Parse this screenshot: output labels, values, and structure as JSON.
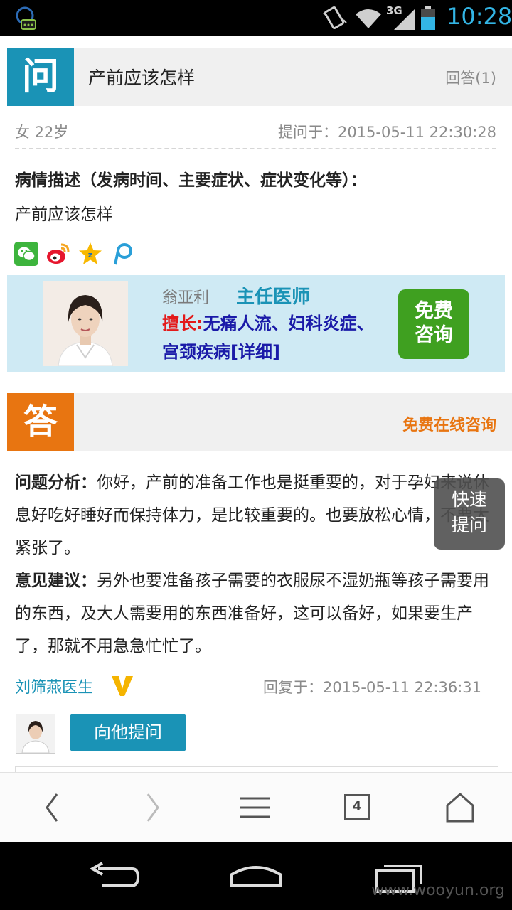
{
  "status_bar": {
    "time": "10:28",
    "network": "3G"
  },
  "question": {
    "badge": "问",
    "title": "产前应该怎样",
    "answer_count": "回答(1)",
    "patient": "女 22岁",
    "asked_at": "提问于：2015-05-11 22:30:28",
    "description_label": "病情描述（发病时间、主要症状、症状变化等）：",
    "description": "产前应该怎样"
  },
  "share_icons": [
    "wechat-icon",
    "weibo-icon",
    "qzone-icon",
    "pengyou-icon"
  ],
  "ad": {
    "doctor_name": "翁亚利",
    "doctor_title": "主任医师",
    "skill_label": "擅长:",
    "skill_text": "无痛人流、妇科炎症、宫颈疾病",
    "detail_link": "[详细]",
    "button_line1": "免费",
    "button_line2": "咨询"
  },
  "answer": {
    "badge": "答",
    "consult_link": "免费在线咨询",
    "analysis_label": "问题分析：",
    "analysis_text": "你好，产前的准备工作也是挺重要的，对于孕妇来说休息好吃好睡好而保持体力，是比较重要的。也要放松心情，不要太紧张了。",
    "advice_label": "意见建议：",
    "advice_text": "另外也要准备孩子需要的衣服尿不湿奶瓶等孩子需要用的东西，及大人需要用的东西准备好，这可以备好，如果要生产了，那就不用急急忙忙了。",
    "doctor": "刘筛燕医生",
    "replied_at": "回复于：2015-05-11 22:36:31",
    "ask_button": "向他提问"
  },
  "float_button": {
    "line1": "快速",
    "line2": "提问"
  },
  "toolbar": {
    "tab_count": "4"
  },
  "watermark": "www.wooyun.org",
  "colors": {
    "question_badge": "#1a93b6",
    "answer_badge": "#e87511",
    "consult_button": "#3fa020"
  }
}
